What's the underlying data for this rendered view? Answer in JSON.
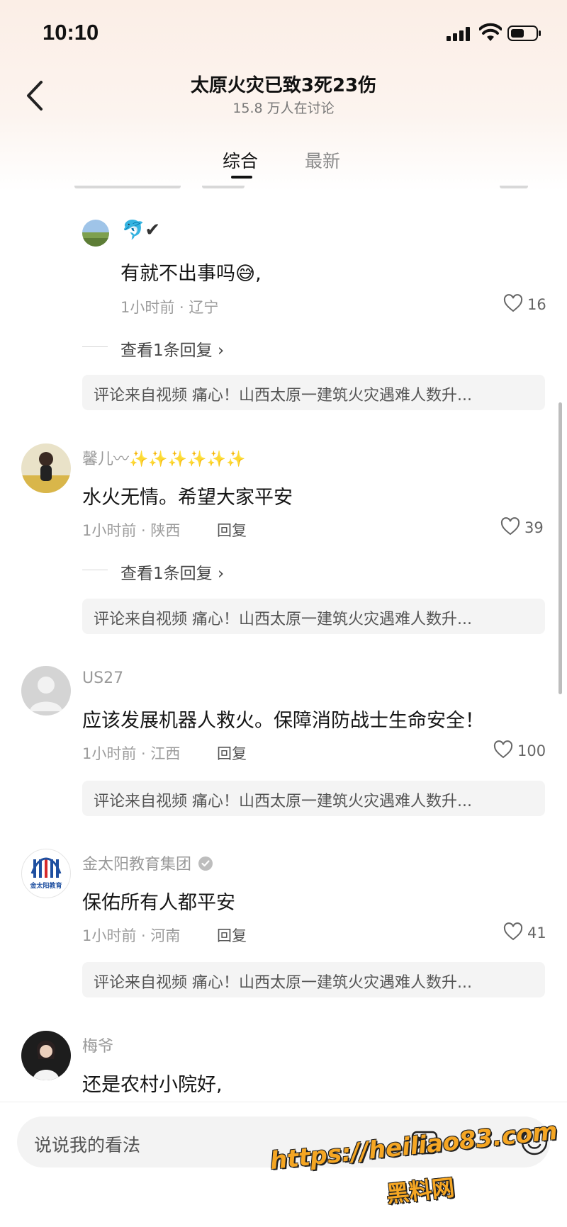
{
  "status_bar": {
    "time": "10:10"
  },
  "header": {
    "title": "太原火灾已致3死23伤",
    "subtitle": "15.8 万人在讨论"
  },
  "tabs": [
    {
      "label": "综合",
      "active": true
    },
    {
      "label": "最新",
      "active": false
    }
  ],
  "comments": [
    {
      "name": "🐬✔",
      "text": "有就不出事吗😅,",
      "meta": "1小时前 · 辽宁",
      "likes": "16",
      "view_replies": "查看1条回复 ›",
      "source": "评论来自视频 痛心！山西太原一建筑火灾遇难人数升..."
    },
    {
      "name": "馨儿〰✨✨✨✨✨✨",
      "text": "水火无情。希望大家平安",
      "meta": "1小时前 · 陕西",
      "reply": "回复",
      "likes": "39",
      "view_replies": "查看1条回复 ›",
      "source": "评论来自视频 痛心！山西太原一建筑火灾遇难人数升..."
    },
    {
      "name": "US27",
      "text": "应该发展机器人救火。保障消防战士生命安全！",
      "meta": "1小时前 · 江西",
      "reply": "回复",
      "likes": "100",
      "source": "评论来自视频 痛心！山西太原一建筑火灾遇难人数升..."
    },
    {
      "name": "金太阳教育集团",
      "avatar_text": "金太阳教育",
      "text": "保佑所有人都平安",
      "meta": "1小时前 · 河南",
      "reply": "回复",
      "likes": "41",
      "source": "评论来自视频 痛心！山西太原一建筑火灾遇难人数升..."
    },
    {
      "name": "梅爷",
      "text": "还是农村小院好,"
    }
  ],
  "bottom_bar": {
    "placeholder": "说说我的看法"
  },
  "watermark": {
    "url": "https://heiliao83.com",
    "name": "黑料网"
  },
  "colors": {
    "source_box": "#f4f4f4",
    "watermark": "#f5a623"
  }
}
